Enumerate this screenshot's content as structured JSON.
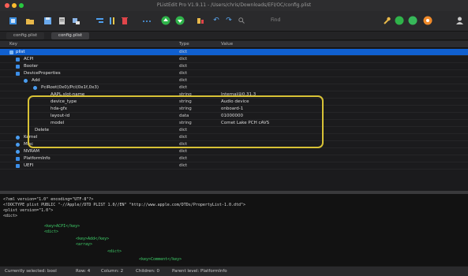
{
  "window": {
    "title": "PListEdit Pro V1.9.11 - /Users/chris/Downloads/EFI/OC/config.plist"
  },
  "toolbar": {
    "find_placeholder": "Find"
  },
  "tabs": [
    {
      "label": "config.plist"
    },
    {
      "label": "config.plist"
    }
  ],
  "tree": {
    "headers": {
      "key": "Key",
      "type": "Type",
      "value": "Value"
    },
    "rows": [
      {
        "key": "plist",
        "type": "dict",
        "value": ""
      },
      {
        "key": "ACPI",
        "type": "dict",
        "value": ""
      },
      {
        "key": "Booter",
        "type": "dict",
        "value": ""
      },
      {
        "key": "DeviceProperties",
        "type": "dict",
        "value": ""
      },
      {
        "key": "Add",
        "type": "dict",
        "value": ""
      },
      {
        "key": "PciRoot(0x0)/Pci(0x1f,0x3)",
        "type": "dict",
        "value": ""
      },
      {
        "key": "AAPL,slot-name",
        "type": "string",
        "value": "Internal@0,31,3"
      },
      {
        "key": "device_type",
        "type": "string",
        "value": "Audio device"
      },
      {
        "key": "hda-gfx",
        "type": "string",
        "value": "onboard-1"
      },
      {
        "key": "layout-id",
        "type": "data",
        "value": "01000000"
      },
      {
        "key": "model",
        "type": "string",
        "value": "Comet Lake PCH cAVS"
      },
      {
        "key": "Delete",
        "type": "dict",
        "value": ""
      },
      {
        "key": "Kernel",
        "type": "dict",
        "value": ""
      },
      {
        "key": "Misc",
        "type": "dict",
        "value": ""
      },
      {
        "key": "NVRAM",
        "type": "dict",
        "value": ""
      },
      {
        "key": "PlatformInfo",
        "type": "dict",
        "value": ""
      },
      {
        "key": "UEFI",
        "type": "dict",
        "value": ""
      }
    ]
  },
  "source": {
    "lines": [
      "<?xml version=\"1.0\" encoding=\"UTF-8\"?>",
      "<!DOCTYPE plist PUBLIC \"-//Apple//DTD PLIST 1.0//EN\" \"http://www.apple.com/DTDs/PropertyList-1.0.dtd\">",
      "<plist version=\"1.0\">",
      "<dict>",
      "<key>ACPI</key>",
      "<dict>",
      "<key>Add</key>",
      "<array>",
      "<dict>",
      "<key>Comment</key>"
    ]
  },
  "status": {
    "selected": "Currently selected: bool",
    "row": "Row: 4",
    "column": "Column: 2",
    "children": "Children: 0",
    "parent": "Parent level: PlatformInfo"
  },
  "colors": {
    "selection": "#1060d0",
    "highlight_box": "#d8c236",
    "xml_tag": "#3fd06a"
  }
}
